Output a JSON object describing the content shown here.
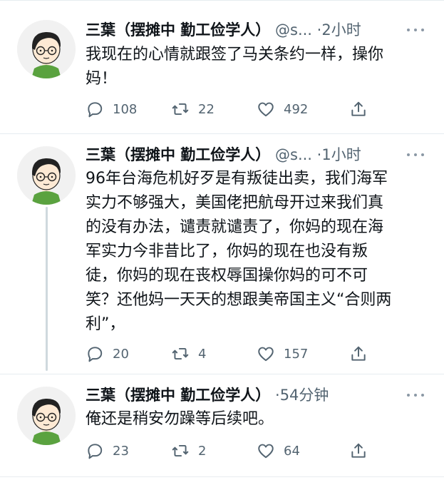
{
  "tweets": [
    {
      "name": "三葉（摆摊中 勤工俭学人）",
      "handle": "@s...",
      "separator": "·",
      "time": "2小时",
      "lines": [
        "我现在的心情就跟签了马关条约一样，操你",
        "妈！"
      ],
      "replies": "108",
      "retweets": "22",
      "likes": "492"
    },
    {
      "name": "三葉（摆摊中 勤工俭学人）",
      "handle": "@s...",
      "separator": "·",
      "time": "1小时",
      "lines": [
        "96年台海危机好歹是有叛徒出卖，我们海军",
        "实力不够强大，美国佬把航母开过来我们真",
        "的没有办法，谴责就谴责了，你妈的现在海",
        "军实力今非昔比了，你妈的现在也没有叛",
        "徒，你妈的现在丧权辱国操你妈的可不可",
        "笑？还他妈一天天的想跟美帝国主义“合则两",
        "利”，"
      ],
      "replies": "20",
      "retweets": "4",
      "likes": "157"
    },
    {
      "name": "三葉（摆摊中 勤工俭学人）",
      "handle": "",
      "separator": "·",
      "time": "54分钟",
      "lines": [
        "俺还是稍安勿躁等后续吧。"
      ],
      "replies": "23",
      "retweets": "2",
      "likes": "64"
    }
  ],
  "icons": {
    "avatar": "cartoon-boy-with-glasses",
    "reply": "speech-bubble-icon",
    "retweet": "retweet-arrows-icon",
    "like": "heart-icon",
    "share": "share-upload-icon",
    "more": "more-dots-icon"
  }
}
